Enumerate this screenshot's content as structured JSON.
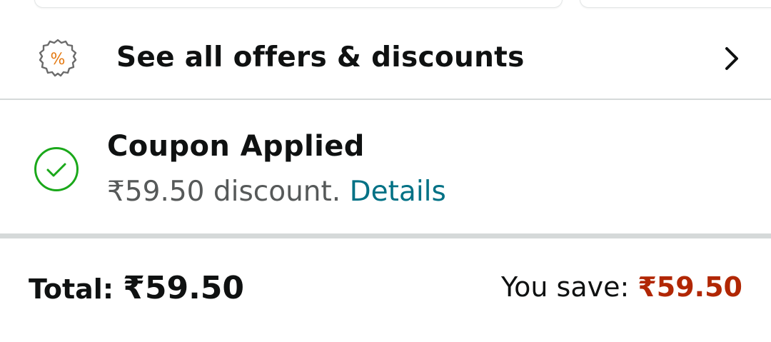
{
  "offers": {
    "label": "See all offers & discounts",
    "icon": "percent-badge-icon",
    "chevron_icon": "chevron-right-icon",
    "accent_color": "#e47911"
  },
  "coupon": {
    "title": "Coupon Applied",
    "discount_text": "₹59.50 discount.",
    "details_link": "Details",
    "icon": "check-circle-icon",
    "icon_color": "#1aa81a"
  },
  "totals": {
    "total_label": "Total: ",
    "total_value": "₹59.50",
    "save_label": "You save: ",
    "save_value": "₹59.50",
    "save_color": "#b12704"
  }
}
